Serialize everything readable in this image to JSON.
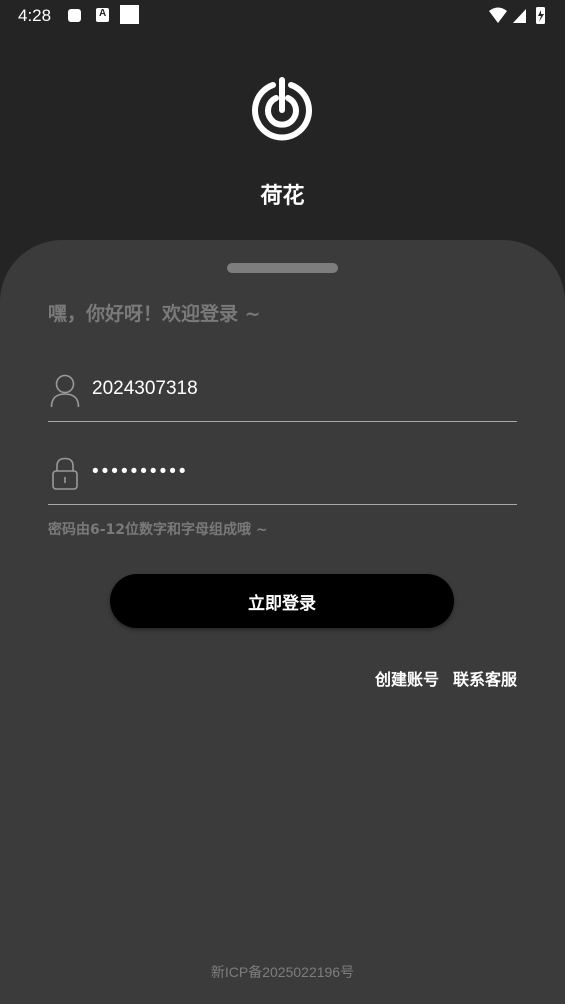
{
  "status_bar": {
    "time": "4:28",
    "icons": [
      "notification-icon",
      "app-a-icon",
      "blank-square-icon",
      "wifi-icon",
      "signal-icon",
      "battery-charging-icon"
    ]
  },
  "header": {
    "logo_icon": "app-logo-icon",
    "app_name": "荷花"
  },
  "login_card": {
    "greeting": "嘿，你好呀！欢迎登录 ~",
    "username": {
      "icon": "user-icon",
      "value": "2024307318"
    },
    "password": {
      "icon": "lock-icon",
      "value": "••••••••••"
    },
    "password_hint": "密码由6-12位数字和字母组成哦 ~",
    "login_button": "立即登录",
    "links": {
      "create_account": "创建账号",
      "contact_support": "联系客服"
    },
    "icp": "新ICP备2025022196号"
  },
  "colors": {
    "background": "#242424",
    "card": "#3b3b3b",
    "muted_text": "#7a7a7a",
    "button": "#000000"
  }
}
